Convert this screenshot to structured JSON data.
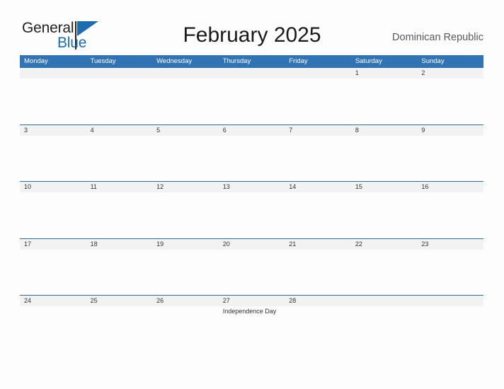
{
  "brand": {
    "name_part1": "General",
    "name_part2": "Blue",
    "accent_color": "#1b6cb0"
  },
  "header": {
    "title": "February 2025",
    "country": "Dominican Republic",
    "header_bg_color": "#3174b5",
    "date_band_color": "#f2f2f2",
    "rule_color": "#2e6da4"
  },
  "weekdays": [
    {
      "label": "Monday"
    },
    {
      "label": "Tuesday"
    },
    {
      "label": "Wednesday"
    },
    {
      "label": "Thursday"
    },
    {
      "label": "Friday"
    },
    {
      "label": "Saturday"
    },
    {
      "label": "Sunday"
    }
  ],
  "weeks": [
    {
      "days": [
        {
          "date": "",
          "event": ""
        },
        {
          "date": "",
          "event": ""
        },
        {
          "date": "",
          "event": ""
        },
        {
          "date": "",
          "event": ""
        },
        {
          "date": "",
          "event": ""
        },
        {
          "date": "1",
          "event": ""
        },
        {
          "date": "2",
          "event": ""
        }
      ]
    },
    {
      "days": [
        {
          "date": "3",
          "event": ""
        },
        {
          "date": "4",
          "event": ""
        },
        {
          "date": "5",
          "event": ""
        },
        {
          "date": "6",
          "event": ""
        },
        {
          "date": "7",
          "event": ""
        },
        {
          "date": "8",
          "event": ""
        },
        {
          "date": "9",
          "event": ""
        }
      ]
    },
    {
      "days": [
        {
          "date": "10",
          "event": ""
        },
        {
          "date": "11",
          "event": ""
        },
        {
          "date": "12",
          "event": ""
        },
        {
          "date": "13",
          "event": ""
        },
        {
          "date": "14",
          "event": ""
        },
        {
          "date": "15",
          "event": ""
        },
        {
          "date": "16",
          "event": ""
        }
      ]
    },
    {
      "days": [
        {
          "date": "17",
          "event": ""
        },
        {
          "date": "18",
          "event": ""
        },
        {
          "date": "19",
          "event": ""
        },
        {
          "date": "20",
          "event": ""
        },
        {
          "date": "21",
          "event": ""
        },
        {
          "date": "22",
          "event": ""
        },
        {
          "date": "23",
          "event": ""
        }
      ]
    },
    {
      "days": [
        {
          "date": "24",
          "event": ""
        },
        {
          "date": "25",
          "event": ""
        },
        {
          "date": "26",
          "event": ""
        },
        {
          "date": "27",
          "event": "Independence Day"
        },
        {
          "date": "28",
          "event": ""
        },
        {
          "date": "",
          "event": ""
        },
        {
          "date": "",
          "event": ""
        }
      ]
    }
  ]
}
